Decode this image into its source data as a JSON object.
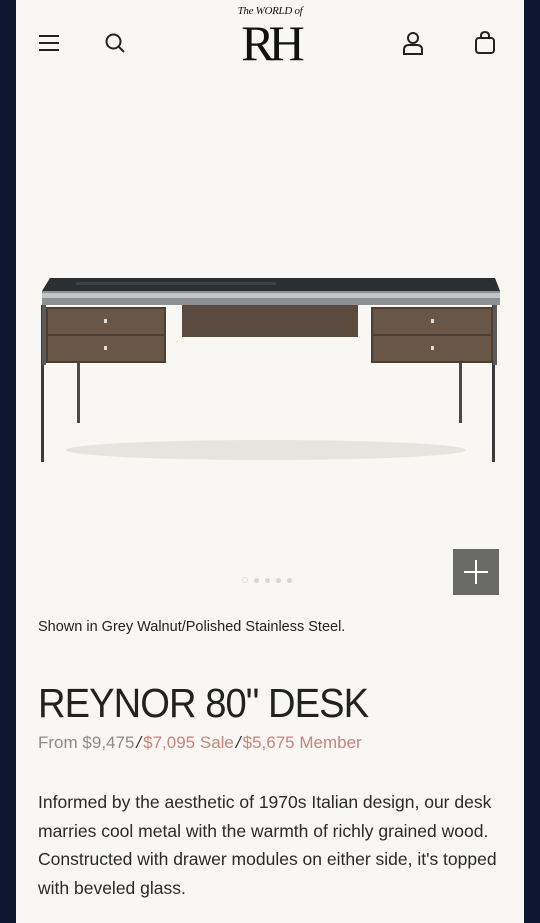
{
  "header": {
    "logo_top": "The WORLD of",
    "logo_main": "RH"
  },
  "icons": {
    "menu": "menu-icon",
    "search": "search-icon",
    "account": "account-icon",
    "cart": "shopping-bag-icon",
    "zoom": "plus-icon"
  },
  "gallery": {
    "slide_count": 5,
    "active_slide": 1
  },
  "product": {
    "caption": "Shown in Grey Walnut/Polished Stainless Steel.",
    "title": "REYNOR 80\" DESK",
    "price_from_label": "From",
    "price_regular": "$9,475",
    "price_sale": "$7,095 Sale",
    "price_member": "$5,675 Member",
    "separator": "/",
    "description": "Informed by the aesthetic of 1970s Italian design, our desk marries cool metal with the warmth of richly grained wood. Constructed with drawer modules on either side, it's topped with beveled glass."
  },
  "colors": {
    "background_frame": "#0c1730",
    "page": "#f8f7f4",
    "sale_price": "#c88478",
    "zoom_button": "#6a6a68"
  }
}
